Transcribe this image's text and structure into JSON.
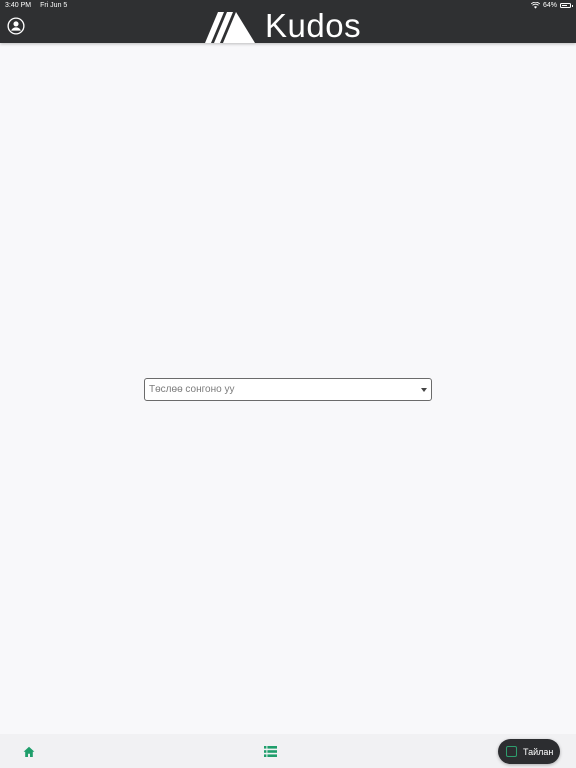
{
  "status_bar": {
    "time": "3:40 PM",
    "date": "Fri Jun 5",
    "battery": "64%",
    "icons": [
      "wifi-icon",
      "battery-icon"
    ]
  },
  "header": {
    "app_name": "Kudos",
    "profile_icon": "user-circle-icon",
    "logo_icon": "kudos-mountain-logo"
  },
  "main": {
    "device_select": {
      "placeholder": "Төслөө сонгоно уу",
      "value": ""
    }
  },
  "bottom_nav": {
    "home_icon": "home-icon",
    "list_icon": "list-icon",
    "report_button": {
      "label": "Тайлан",
      "icon": "report-square-icon"
    },
    "accent_color": "#1f9e6b"
  },
  "colors": {
    "header_bg": "#2f3032",
    "page_bg": "#f8f8fa",
    "accent": "#1f9e6b"
  }
}
